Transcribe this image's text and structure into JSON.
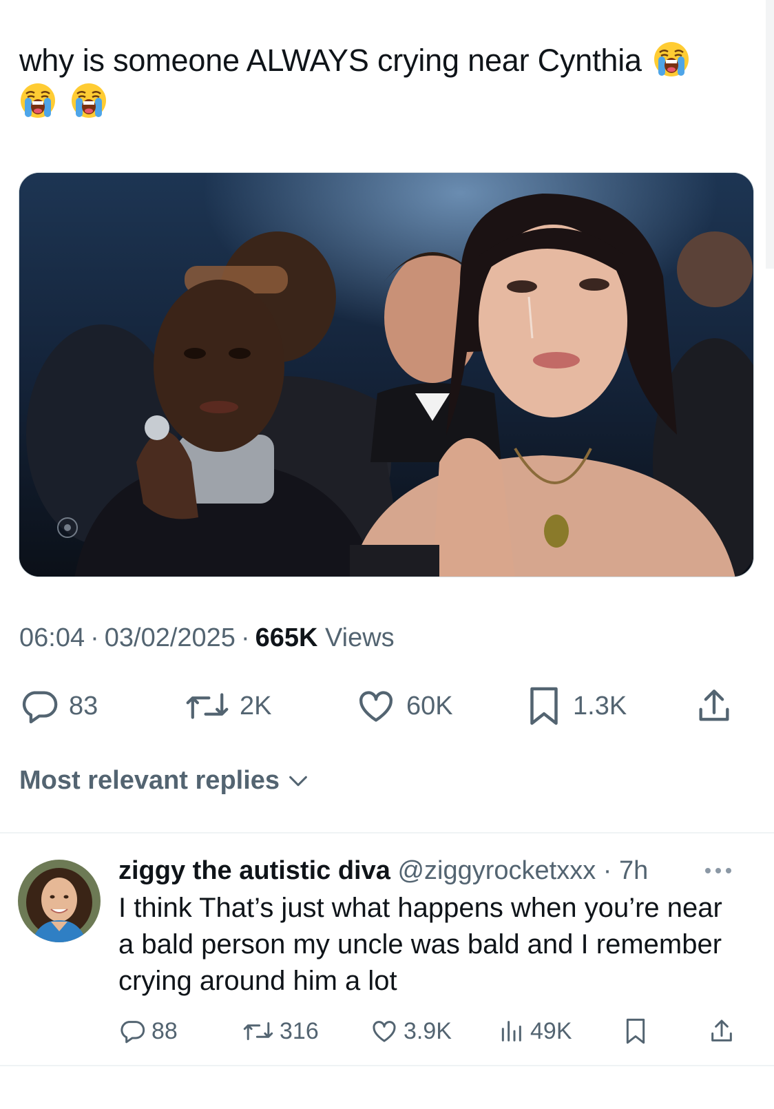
{
  "tweet": {
    "text": "why is someone ALWAYS crying near Cynthia",
    "emoji": [
      "loudly-crying-face",
      "loudly-crying-face",
      "loudly-crying-face"
    ],
    "media_alt": "Two women at an awards ceremony, one with tears on her face, hands pressed together",
    "time": "06:04",
    "date": "03/02/2025",
    "views_count": "665K",
    "views_label": "Views"
  },
  "actions": {
    "replies": "83",
    "reposts": "2K",
    "likes": "60K",
    "bookmarks": "1.3K"
  },
  "replies_section": {
    "sort_label": "Most relevant replies"
  },
  "reply": {
    "author_name": "ziggy the autistic diva",
    "author_handle": "@ziggyrocketxxx",
    "age": "7h",
    "text": "I think That’s just what happens when you’re near a bald person my uncle was bald and I remember crying around him a lot",
    "replies": "88",
    "reposts": "316",
    "likes": "3.9K",
    "views": "49K"
  },
  "colors": {
    "text_primary": "#0f1419",
    "text_secondary": "#536471",
    "divider": "#eff3f4"
  }
}
